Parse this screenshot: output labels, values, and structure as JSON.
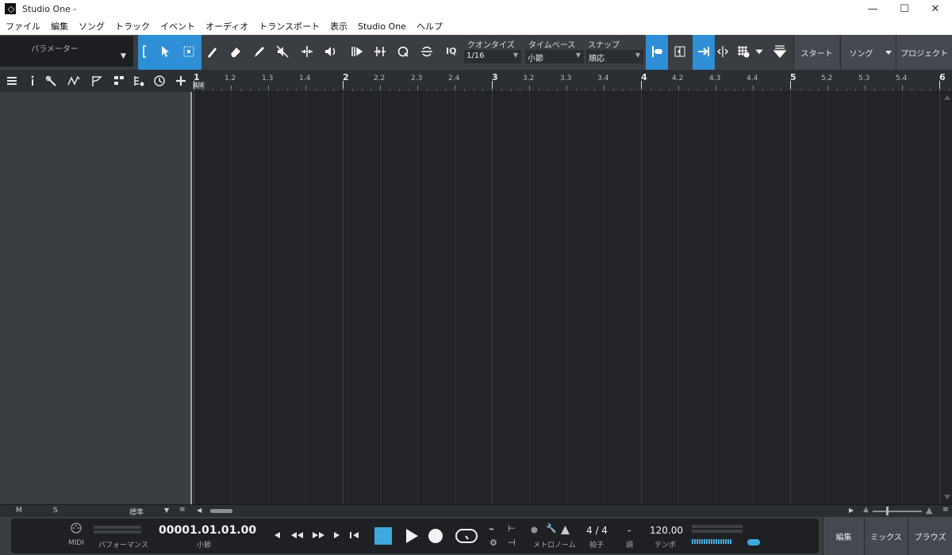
{
  "window": {
    "title": "Studio One -",
    "minimize_glyph": "—",
    "maximize_glyph": "☐",
    "close_glyph": "✕"
  },
  "menu": {
    "items": [
      "ファイル",
      "編集",
      "ソング",
      "トラック",
      "イベント",
      "オーディオ",
      "トランスポート",
      "表示",
      "Studio One",
      "ヘルプ"
    ]
  },
  "toolbar": {
    "parameter_label": "パラメーター",
    "iq_label": "IQ",
    "quantize": {
      "label": "クオンタイズ",
      "value": "1/16"
    },
    "timebase": {
      "label": "タイムベース",
      "value": "小節"
    },
    "snap": {
      "label": "スナップ",
      "value": "順応"
    },
    "start_button": "スタート",
    "song_button": "ソング",
    "project_button": "プロジェクト",
    "accent_color": "#2f8fd6"
  },
  "ruler": {
    "time_signature": "4/4",
    "labels": [
      "1",
      "1.2",
      "1.3",
      "1.4",
      "2",
      "2.2",
      "2.3",
      "2.4",
      "3",
      "3.2",
      "3.3",
      "3.4",
      "4",
      "4.2",
      "4.3",
      "4.4",
      "5",
      "5.2",
      "5.3",
      "5.4",
      "6"
    ]
  },
  "bottom_strip": {
    "mute_label": "M",
    "solo_label": "S",
    "preset_value": "標準"
  },
  "transport": {
    "midi_label": "MIDI",
    "performance_label": "パフォーマンス",
    "position_value": "00001.01.01.00",
    "position_unit": "小節",
    "metronome_label": "メトロノーム",
    "time_sig_value": "4 / 4",
    "time_sig_label": "拍子",
    "key_value": "-",
    "key_label": "調",
    "tempo_value": "120.00",
    "tempo_label": "テンポ"
  },
  "view_buttons": {
    "edit": "編集",
    "mix": "ミックス",
    "browse": "ブラウズ"
  }
}
